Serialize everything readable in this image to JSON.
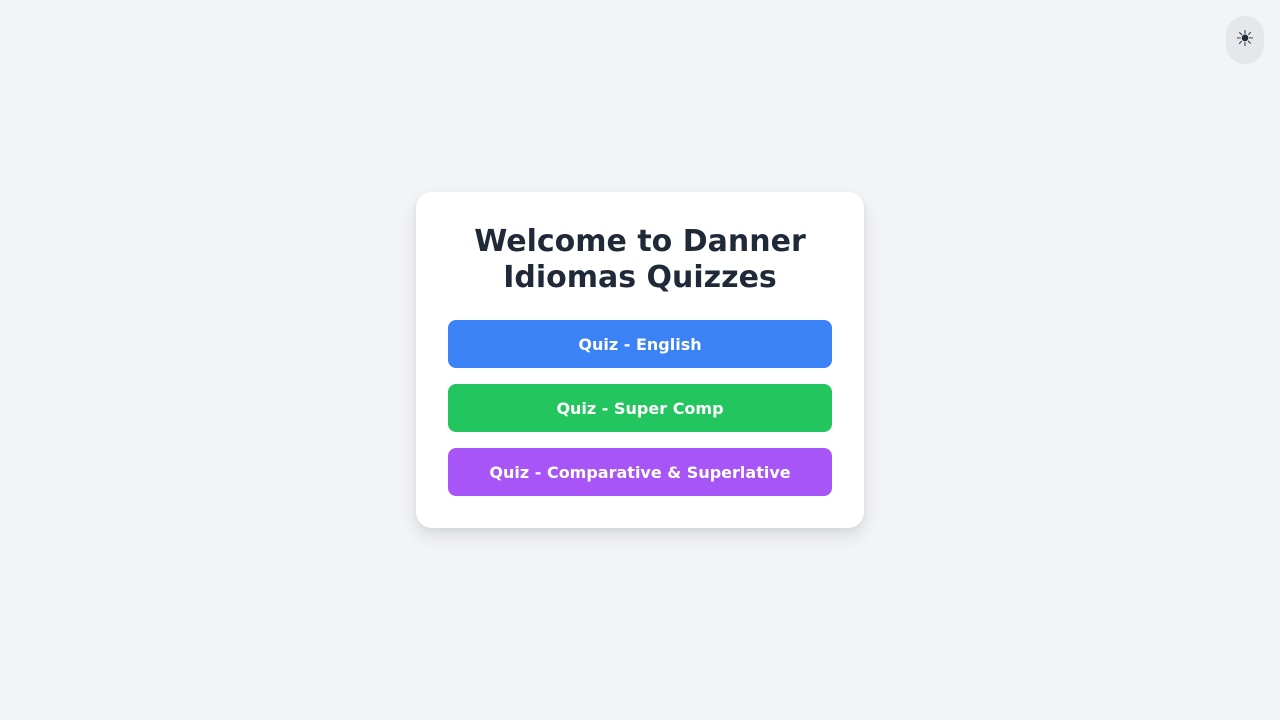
{
  "theme_toggle": {
    "icon": "sun-icon",
    "glyph": "☀"
  },
  "card": {
    "title": "Welcome to Danner Idiomas Quizzes",
    "buttons": [
      {
        "label": "Quiz - English",
        "color": "#3b82f6"
      },
      {
        "label": "Quiz - Super Comp",
        "color": "#22c55e"
      },
      {
        "label": "Quiz - Comparative & Superlative",
        "color": "#a855f7"
      }
    ]
  }
}
